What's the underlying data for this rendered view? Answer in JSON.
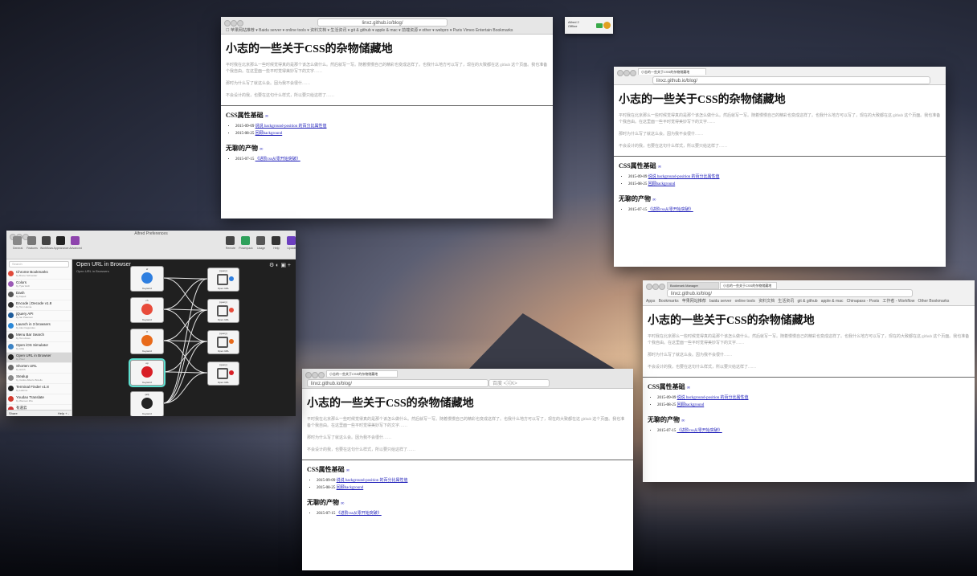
{
  "page": {
    "title": "小志的一些关于CSS的杂物储藏地",
    "intro": [
      "平时我在北京那么一些时候觉得真的是那个该怎么做什么。然后就写一写。随着慢慢自己的精彩也变成这样了。也我什么地方可以写了，现在的大致都在这 github 这个页面。我也准备个我自由。在这里面一些平时觉得美妙写下的文字……",
      "那时为什么写了就这么会。因为我不会很什……",
      "不会设计的我，也要在这句什么样式，所以要只给这样了……"
    ],
    "section1": "CSS属性基础",
    "section1_items": [
      {
        "date": "2015-09-09",
        "link": "说说 background-position 的百分比属性值"
      },
      {
        "date": "2015-08-25",
        "link": "回顾background"
      }
    ],
    "section2": "无聊的产物",
    "section2_items": [
      {
        "date": "2015-07-15",
        "link": "《进阶css从零开始突破》"
      }
    ],
    "anchor": "∞"
  },
  "tray": {
    "line1": "Alfred 2",
    "line2": "Offline"
  },
  "win_safari": {
    "url": "linxz.github.io/blog/",
    "bookmarks": "☐  苹果网站推荐 ▾  Baidu server ▾  online tools ▾  资料文档 ▾  生活资讯 ▾  git & github ▾  apple & mac ▾  前端资源 ▾  other ▾  webpro ▾  Paris  Vimeo  Entertain  Bookmarks"
  },
  "win_chrome_top": {
    "tab": "小志的一些关于CSS的杂物储藏地",
    "url": "linxz.github.io/blog/"
  },
  "win_chrome_right": {
    "tabs": [
      "Bookmark Manager",
      "小志的一些关于CSS的杂物储藏地"
    ],
    "url": "linxz.github.io/blog/",
    "bookmarks": [
      "Apps",
      "Bookmarks",
      "苹果网站推荐",
      "baidu server",
      "online tools",
      "资料文档",
      "生活资讯",
      "git & github",
      "apple & mac",
      "Chinapass - Posts",
      "工作者 - Workflow",
      "Other Bookmarks"
    ]
  },
  "win_firefox": {
    "tab": "小志的一些关于CSS的杂物储藏地",
    "url": "linxz.github.io/blog/",
    "search_placeholder": "百度 <⌘K>"
  },
  "alfred": {
    "title": "Alfred Preferences",
    "toolbar": [
      "General",
      "Features",
      "Workflows",
      "Appearance",
      "Advanced",
      "Remote",
      "Powerpack",
      "Usage",
      "Help",
      "Update"
    ],
    "search": "Search",
    "workflow_title": "Open URL in Browser",
    "workflow_sub": "Open URL in Browsers",
    "workflows": [
      {
        "t": "Chrome Bookmarks",
        "s": "by Bruno Schneider",
        "c": "#e0493a"
      },
      {
        "t": "Colors",
        "s": "by Tyler Eich",
        "c": "#9b59b6"
      },
      {
        "t": "Dash",
        "s": "by Kapeli",
        "c": "#555555"
      },
      {
        "t": "Encode | Decode v1.8",
        "s": "by Tom Hanna",
        "c": "#333333"
      },
      {
        "t": "jQuery API",
        "s": "by Ian Paterson",
        "c": "#1d5b9a"
      },
      {
        "t": "Launch in 3 browsers",
        "s": "by Alex Fagundes",
        "c": "#2a88d8"
      },
      {
        "t": "Menu Bar Search",
        "s": "by Tom Alves",
        "c": "#444444"
      },
      {
        "t": "Open iOS Simulator",
        "s": "by Arka",
        "c": "#3b82c4"
      },
      {
        "t": "Open URL in Browser",
        "s": "by Pixel",
        "c": "#222222"
      },
      {
        "t": "Shorten URL",
        "s": "by Hzlzh",
        "c": "#6a6a6a"
      },
      {
        "t": "Stealup",
        "s": "by Carlos Alberto Botello",
        "c": "#888888"
      },
      {
        "t": "Terminal Finder v1.8",
        "s": "by LeEnno",
        "c": "#222222"
      },
      {
        "t": "Youdao Translate",
        "s": "by Wensen Zhu",
        "c": "#d23a2e"
      },
      {
        "t": "有道云",
        "s": "by Mantra",
        "c": "#cc3333"
      }
    ],
    "footer_left": "Share",
    "footer_right": "Help  +  -",
    "nodes": [
      {
        "k": "sf",
        "n": "Keyword",
        "c": "#2f7fe0"
      },
      {
        "k": "ch",
        "n": "Keyword",
        "c": "#e84b3a"
      },
      {
        "k": "ff",
        "n": "Keyword",
        "c": "#e86a1a"
      },
      {
        "k": "op",
        "n": "Keyword",
        "c": "#d81f26"
      },
      {
        "k": "{all}",
        "n": "Keyword",
        "c": "#222222"
      }
    ],
    "action_label": "Open URL",
    "action_key": "{query}",
    "action_colors": [
      "#2f7fe0",
      "#e84b3a",
      "#e86a1a",
      "#d81f26"
    ]
  }
}
